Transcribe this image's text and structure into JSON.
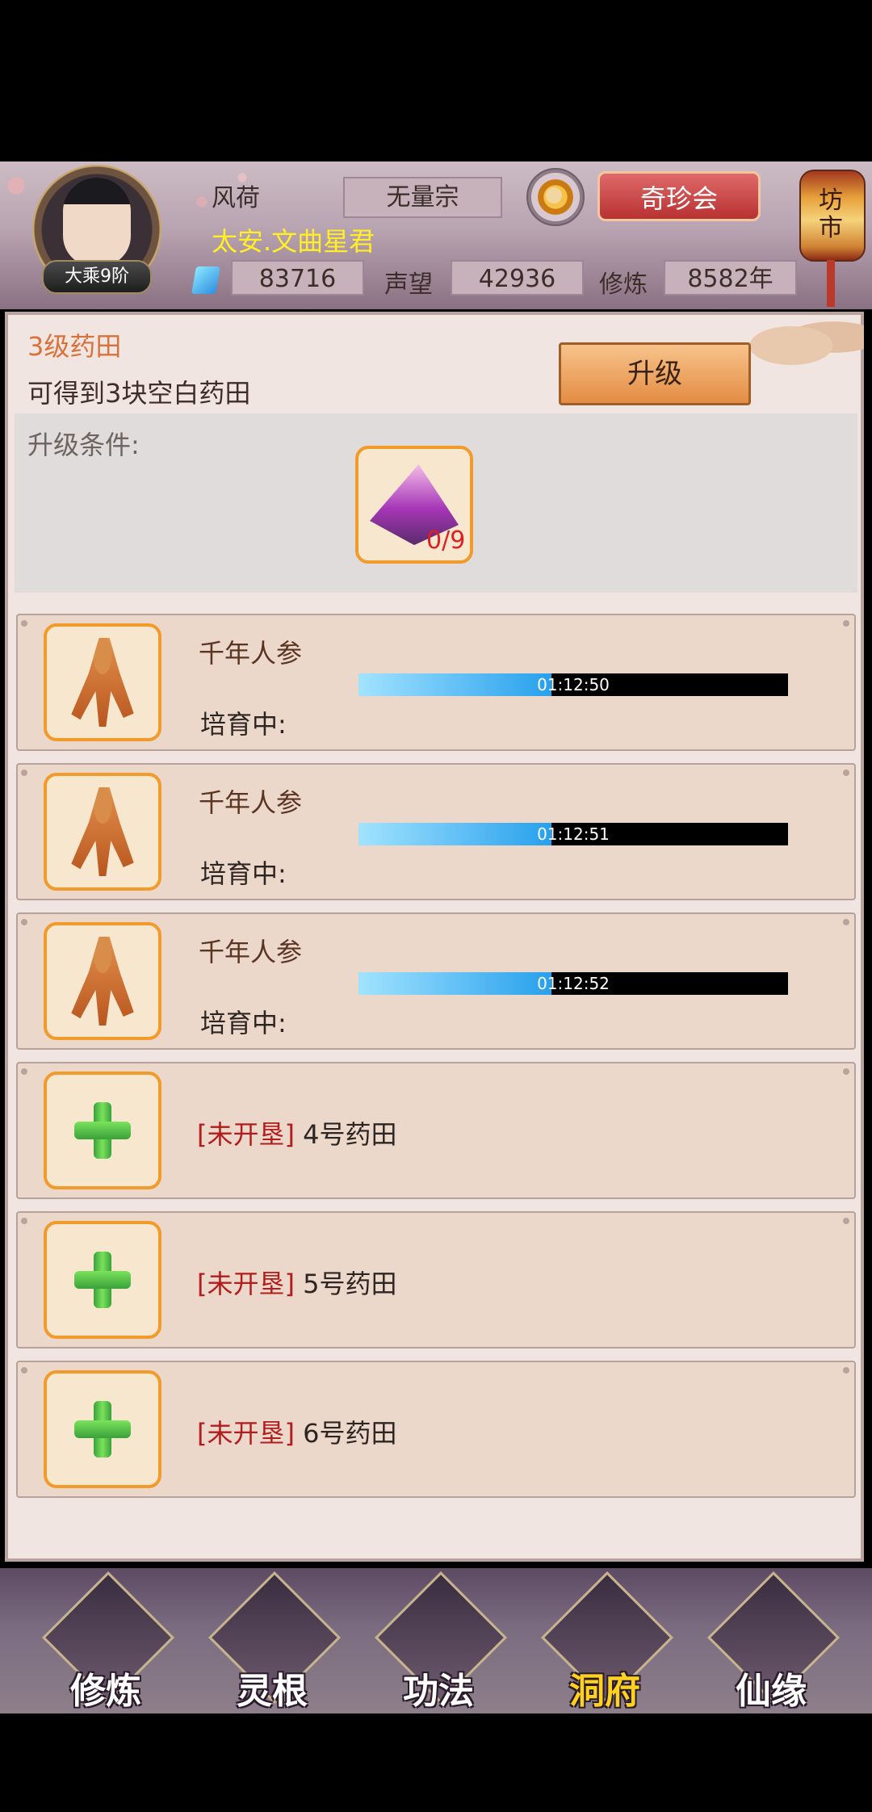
{
  "player": {
    "name": "风荷",
    "rank": "大乘9阶",
    "sect": "无量宗",
    "title": "太安.文曲星君",
    "spirit_stones": "83716",
    "reputation_label": "声望",
    "reputation": "42936",
    "cultivation_label": "修炼",
    "cultivation": "8582年"
  },
  "header": {
    "treasure_button": "奇珍会",
    "market_lantern": "坊市",
    "settings_icon": "gear-icon"
  },
  "field": {
    "level_title": "3级药田",
    "description": "可得到3块空白药田",
    "upgrade_button": "升级",
    "conditions_label": "升级条件:",
    "required_item_count": "0/9"
  },
  "plots": [
    {
      "herb": "千年人参",
      "status": "培育中:",
      "timer": "01:12:50",
      "progress": 0.45
    },
    {
      "herb": "千年人参",
      "status": "培育中:",
      "timer": "01:12:51",
      "progress": 0.45
    },
    {
      "herb": "千年人参",
      "status": "培育中:",
      "timer": "01:12:52",
      "progress": 0.45
    }
  ],
  "locked_plots": [
    {
      "tag": "[未开垦]",
      "name": "4号药田"
    },
    {
      "tag": "[未开垦]",
      "name": "5号药田"
    },
    {
      "tag": "[未开垦]",
      "name": "6号药田"
    }
  ],
  "nav": [
    {
      "label": "修炼",
      "active": false
    },
    {
      "label": "灵根",
      "active": false
    },
    {
      "label": "功法",
      "active": false
    },
    {
      "label": "洞府",
      "active": true
    },
    {
      "label": "仙缘",
      "active": false
    }
  ]
}
